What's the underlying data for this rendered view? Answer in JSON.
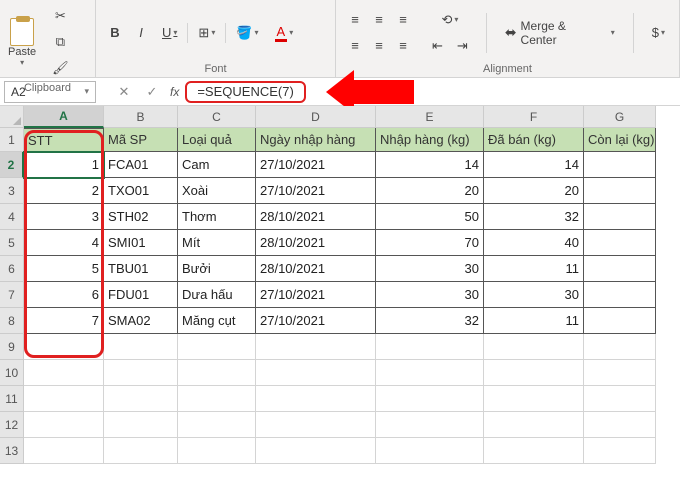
{
  "ribbon": {
    "paste_label": "Paste",
    "clipboard_label": "Clipboard",
    "font_label": "Font",
    "alignment_label": "Alignment",
    "merge_label": "Merge & Center",
    "bold": "B",
    "italic": "I",
    "underline": "U",
    "currency": "$"
  },
  "namebox": "A2",
  "formula": "=SEQUENCE(7)",
  "fx": "fx",
  "cancel": "✕",
  "confirm": "✓",
  "columns": [
    "A",
    "B",
    "C",
    "D",
    "E",
    "F",
    "G"
  ],
  "headers": {
    "A": "STT",
    "B": "Mã SP",
    "C": "Loại quả",
    "D": "Ngày nhập hàng",
    "E": "Nhập hàng (kg)",
    "F": "Đã bán (kg)",
    "G": "Còn lại (kg)"
  },
  "rows": [
    {
      "n": 1,
      "A": "1",
      "B": "FCA01",
      "C": "Cam",
      "D": "27/10/2021",
      "E": "14",
      "F": "14"
    },
    {
      "n": 2,
      "A": "2",
      "B": "TXO01",
      "C": "Xoài",
      "D": "27/10/2021",
      "E": "20",
      "F": "20"
    },
    {
      "n": 3,
      "A": "3",
      "B": "STH02",
      "C": "Thơm",
      "D": "28/10/2021",
      "E": "50",
      "F": "32"
    },
    {
      "n": 4,
      "A": "4",
      "B": "SMI01",
      "C": "Mít",
      "D": "28/10/2021",
      "E": "70",
      "F": "40"
    },
    {
      "n": 5,
      "A": "5",
      "B": "TBU01",
      "C": "Bưởi",
      "D": "28/10/2021",
      "E": "30",
      "F": "11"
    },
    {
      "n": 6,
      "A": "6",
      "B": "FDU01",
      "C": "Dưa hấu",
      "D": "27/10/2021",
      "E": "30",
      "F": "30"
    },
    {
      "n": 7,
      "A": "7",
      "B": "SMA02",
      "C": "Măng cụt",
      "D": "27/10/2021",
      "E": "32",
      "F": "11"
    }
  ],
  "row_labels": [
    "1",
    "2",
    "3",
    "4",
    "5",
    "6",
    "7",
    "8",
    "9",
    "10",
    "11",
    "12",
    "13"
  ]
}
